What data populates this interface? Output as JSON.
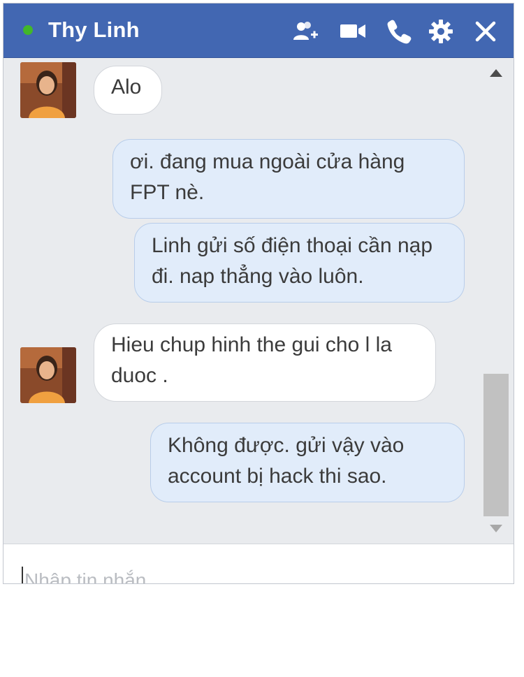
{
  "header": {
    "title": "Thy Linh",
    "status_color": "#42b72a",
    "icons": [
      "add-people-icon",
      "video-call-icon",
      "phone-icon",
      "gear-icon",
      "close-icon"
    ]
  },
  "messages": [
    {
      "from": "contact",
      "text": "Alo"
    },
    {
      "from": "me",
      "text": "ơi. đang mua ngoài cửa hàng FPT nè."
    },
    {
      "from": "me",
      "text": "Linh gửi số điện thoại cần nạp đi. nap thẳng vào luôn."
    },
    {
      "from": "contact",
      "text": "Hieu chup hinh the gui cho l la duoc ."
    },
    {
      "from": "me",
      "text": "Không được. gửi vậy vào account bị hack thi sao."
    }
  ],
  "composer": {
    "placeholder": "Nhập tin nhắn..."
  },
  "colors": {
    "header_bg": "#4267b2",
    "chat_bg": "#e9ebee",
    "incoming_bubble": "#ffffff",
    "outgoing_bubble": "#e1ecfa"
  }
}
